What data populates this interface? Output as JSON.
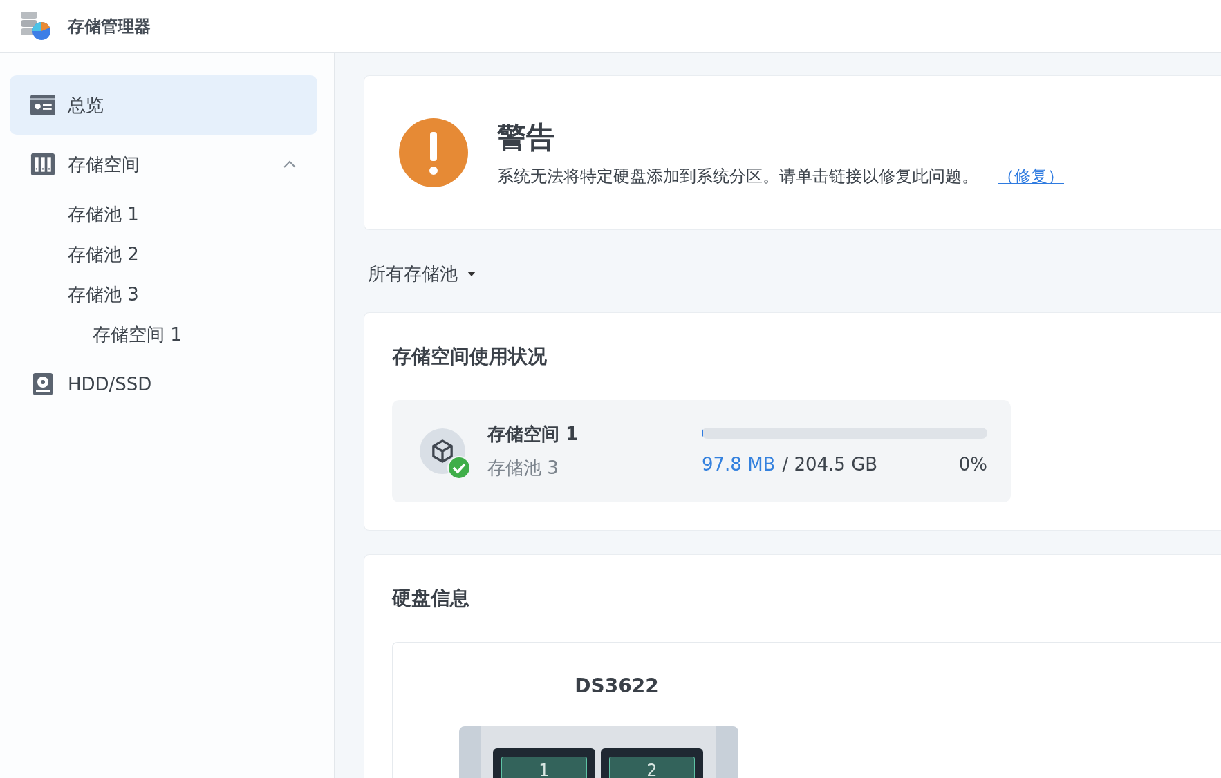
{
  "app": {
    "title": "存储管理器"
  },
  "sidebar": {
    "items": [
      {
        "label": "总览",
        "kind": "overview",
        "selected": true
      },
      {
        "label": "存储空间",
        "kind": "volume",
        "selected": false,
        "expanded": true,
        "children": [
          {
            "label": "存储池 1",
            "selected": false
          },
          {
            "label": "存储池 2",
            "selected": false
          },
          {
            "label": "存储池 3",
            "selected": false,
            "children": [
              {
                "label": "存储空间 1",
                "selected": false
              }
            ]
          }
        ]
      },
      {
        "label": "HDD/SSD",
        "kind": "disk",
        "selected": false
      }
    ]
  },
  "warning": {
    "title": "警告",
    "message": "系统无法将特定硬盘添加到系统分区。请单击链接以修复此问题。",
    "link": "（修复）"
  },
  "pool_filter": {
    "label": "所有存储池"
  },
  "usage": {
    "title": "存储空间使用状况",
    "volumes": [
      {
        "name": "存储空间 1",
        "pool": "存储池 3",
        "healthy": true,
        "level": 0.005,
        "used": "97.8 MB",
        "total": "/ 204.5 GB",
        "percent": "0%"
      }
    ]
  },
  "disks": {
    "title": "硬盘信息",
    "device": {
      "model": "DS3622",
      "slots": [
        "1",
        "2"
      ]
    }
  }
}
